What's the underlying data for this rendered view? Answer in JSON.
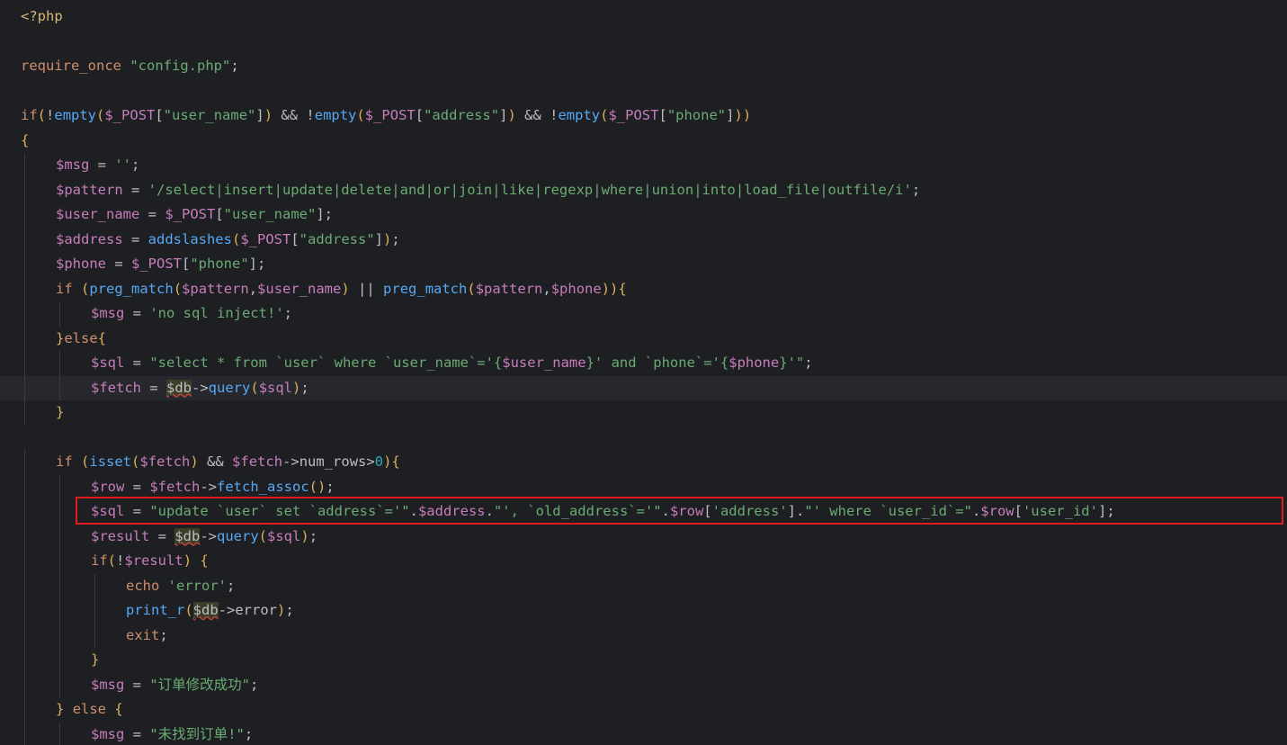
{
  "accent_colors": {
    "keyword": "#cf8e6d",
    "string": "#6aab73",
    "variable": "#c77dbb",
    "function": "#56a8f5",
    "highlight_box": "#e01c1c"
  },
  "lines": [
    {
      "indent": 0,
      "tokens": [
        [
          "tag",
          "<?php"
        ]
      ]
    },
    {
      "indent": 0,
      "tokens": []
    },
    {
      "indent": 0,
      "tokens": [
        [
          "kw",
          "require_once"
        ],
        [
          "pn",
          " "
        ],
        [
          "str",
          "\"config.php\""
        ],
        [
          "pn",
          ";"
        ]
      ]
    },
    {
      "indent": 0,
      "tokens": []
    },
    {
      "indent": 0,
      "tokens": [
        [
          "kw",
          "if"
        ],
        [
          "br",
          "("
        ],
        [
          "op",
          "!"
        ],
        [
          "fn",
          "empty"
        ],
        [
          "br",
          "("
        ],
        [
          "var",
          "$_POST"
        ],
        [
          "pn",
          "["
        ],
        [
          "str",
          "\"user_name\""
        ],
        [
          "pn",
          "]"
        ],
        [
          "br",
          ")"
        ],
        [
          "op",
          " && !"
        ],
        [
          "fn",
          "empty"
        ],
        [
          "br",
          "("
        ],
        [
          "var",
          "$_POST"
        ],
        [
          "pn",
          "["
        ],
        [
          "str",
          "\"address\""
        ],
        [
          "pn",
          "]"
        ],
        [
          "br",
          ")"
        ],
        [
          "op",
          " && !"
        ],
        [
          "fn",
          "empty"
        ],
        [
          "br",
          "("
        ],
        [
          "var",
          "$_POST"
        ],
        [
          "pn",
          "["
        ],
        [
          "str",
          "\"phone\""
        ],
        [
          "pn",
          "]"
        ],
        [
          "br",
          ")"
        ],
        [
          "br",
          ")"
        ]
      ]
    },
    {
      "indent": 0,
      "tokens": [
        [
          "br",
          "{"
        ]
      ]
    },
    {
      "indent": 1,
      "tokens": [
        [
          "var",
          "$msg"
        ],
        [
          "op",
          " = "
        ],
        [
          "str",
          "''"
        ],
        [
          "pn",
          ";"
        ]
      ]
    },
    {
      "indent": 1,
      "tokens": [
        [
          "var",
          "$pattern"
        ],
        [
          "op",
          " = "
        ],
        [
          "str",
          "'/select|insert|update|delete|and|or|join|like|regexp|where|union|into|load_file|outfile/i'"
        ],
        [
          "pn",
          ";"
        ]
      ]
    },
    {
      "indent": 1,
      "tokens": [
        [
          "var",
          "$user_name"
        ],
        [
          "op",
          " = "
        ],
        [
          "var",
          "$_POST"
        ],
        [
          "pn",
          "["
        ],
        [
          "str",
          "\"user_name\""
        ],
        [
          "pn",
          "]"
        ],
        [
          "pn",
          ";"
        ]
      ]
    },
    {
      "indent": 1,
      "tokens": [
        [
          "var",
          "$address"
        ],
        [
          "op",
          " = "
        ],
        [
          "fn",
          "addslashes"
        ],
        [
          "br",
          "("
        ],
        [
          "var",
          "$_POST"
        ],
        [
          "pn",
          "["
        ],
        [
          "str",
          "\"address\""
        ],
        [
          "pn",
          "]"
        ],
        [
          "br",
          ")"
        ],
        [
          "pn",
          ";"
        ]
      ]
    },
    {
      "indent": 1,
      "tokens": [
        [
          "var",
          "$phone"
        ],
        [
          "op",
          " = "
        ],
        [
          "var",
          "$_POST"
        ],
        [
          "pn",
          "["
        ],
        [
          "str",
          "\"phone\""
        ],
        [
          "pn",
          "]"
        ],
        [
          "pn",
          ";"
        ]
      ]
    },
    {
      "indent": 1,
      "tokens": [
        [
          "kw",
          "if"
        ],
        [
          "pn",
          " "
        ],
        [
          "br",
          "("
        ],
        [
          "fn",
          "preg_match"
        ],
        [
          "br",
          "("
        ],
        [
          "var",
          "$pattern"
        ],
        [
          "pn",
          ","
        ],
        [
          "var",
          "$user_name"
        ],
        [
          "br",
          ")"
        ],
        [
          "op",
          " || "
        ],
        [
          "fn",
          "preg_match"
        ],
        [
          "br",
          "("
        ],
        [
          "var",
          "$pattern"
        ],
        [
          "pn",
          ","
        ],
        [
          "var",
          "$phone"
        ],
        [
          "br",
          ")"
        ],
        [
          "br",
          ")"
        ],
        [
          "br",
          "{"
        ]
      ]
    },
    {
      "indent": 2,
      "tokens": [
        [
          "var",
          "$msg"
        ],
        [
          "op",
          " = "
        ],
        [
          "str",
          "'no sql inject!'"
        ],
        [
          "pn",
          ";"
        ]
      ]
    },
    {
      "indent": 1,
      "tokens": [
        [
          "br",
          "}"
        ],
        [
          "kw",
          "else"
        ],
        [
          "br",
          "{"
        ]
      ]
    },
    {
      "indent": 2,
      "tokens": [
        [
          "var",
          "$sql"
        ],
        [
          "op",
          " = "
        ],
        [
          "str",
          "\"select * from `user` where `user_name`='{"
        ],
        [
          "var",
          "$user_name"
        ],
        [
          "str",
          "}' and `phone`='{"
        ],
        [
          "var",
          "$phone"
        ],
        [
          "str",
          "}'\""
        ],
        [
          "pn",
          ";"
        ]
      ]
    },
    {
      "indent": 2,
      "current": true,
      "tokens": [
        [
          "var",
          "$fetch"
        ],
        [
          "op",
          " = "
        ],
        [
          "hl",
          "$db"
        ],
        [
          "op",
          "->"
        ],
        [
          "fn",
          "query"
        ],
        [
          "br",
          "("
        ],
        [
          "var",
          "$sql"
        ],
        [
          "br",
          ")"
        ],
        [
          "pn",
          ";"
        ]
      ]
    },
    {
      "indent": 1,
      "tokens": [
        [
          "br",
          "}"
        ]
      ]
    },
    {
      "indent": 0,
      "tokens": []
    },
    {
      "indent": 1,
      "tokens": [
        [
          "kw",
          "if"
        ],
        [
          "pn",
          " "
        ],
        [
          "br",
          "("
        ],
        [
          "fn",
          "isset"
        ],
        [
          "br",
          "("
        ],
        [
          "var",
          "$fetch"
        ],
        [
          "br",
          ")"
        ],
        [
          "op",
          " && "
        ],
        [
          "var",
          "$fetch"
        ],
        [
          "op",
          "->"
        ],
        [
          "pn",
          "num_rows"
        ],
        [
          "op",
          ">"
        ],
        [
          "num",
          "0"
        ],
        [
          "br",
          ")"
        ],
        [
          "br",
          "{"
        ]
      ]
    },
    {
      "indent": 2,
      "tokens": [
        [
          "var",
          "$row"
        ],
        [
          "op",
          " = "
        ],
        [
          "var",
          "$fetch"
        ],
        [
          "op",
          "->"
        ],
        [
          "fn",
          "fetch_assoc"
        ],
        [
          "br",
          "()"
        ],
        [
          "pn",
          ";"
        ]
      ]
    },
    {
      "indent": 2,
      "boxed": true,
      "tokens": [
        [
          "var",
          "$sql"
        ],
        [
          "op",
          " = "
        ],
        [
          "str",
          "\"update `user` set `address`='\""
        ],
        [
          "op",
          "."
        ],
        [
          "var",
          "$address"
        ],
        [
          "op",
          "."
        ],
        [
          "str",
          "\"', `old_address`='\""
        ],
        [
          "op",
          "."
        ],
        [
          "var",
          "$row"
        ],
        [
          "pn",
          "["
        ],
        [
          "str",
          "'address'"
        ],
        [
          "pn",
          "]"
        ],
        [
          "op",
          "."
        ],
        [
          "str",
          "\"' where `user_id`=\""
        ],
        [
          "op",
          "."
        ],
        [
          "var",
          "$row"
        ],
        [
          "pn",
          "["
        ],
        [
          "str",
          "'user_id'"
        ],
        [
          "pn",
          "]"
        ],
        [
          "pn",
          ";"
        ]
      ]
    },
    {
      "indent": 2,
      "tokens": [
        [
          "var",
          "$result"
        ],
        [
          "op",
          " = "
        ],
        [
          "hl",
          "$db"
        ],
        [
          "op",
          "->"
        ],
        [
          "fn",
          "query"
        ],
        [
          "br",
          "("
        ],
        [
          "var",
          "$sql"
        ],
        [
          "br",
          ")"
        ],
        [
          "pn",
          ";"
        ]
      ]
    },
    {
      "indent": 2,
      "tokens": [
        [
          "kw",
          "if"
        ],
        [
          "br",
          "("
        ],
        [
          "op",
          "!"
        ],
        [
          "var",
          "$result"
        ],
        [
          "br",
          ")"
        ],
        [
          "pn",
          " "
        ],
        [
          "br",
          "{"
        ]
      ]
    },
    {
      "indent": 3,
      "tokens": [
        [
          "kw",
          "echo"
        ],
        [
          "pn",
          " "
        ],
        [
          "str",
          "'error'"
        ],
        [
          "pn",
          ";"
        ]
      ]
    },
    {
      "indent": 3,
      "tokens": [
        [
          "fn",
          "print_r"
        ],
        [
          "br",
          "("
        ],
        [
          "hl",
          "$db"
        ],
        [
          "op",
          "->"
        ],
        [
          "pn",
          "error"
        ],
        [
          "br",
          ")"
        ],
        [
          "pn",
          ";"
        ]
      ]
    },
    {
      "indent": 3,
      "tokens": [
        [
          "kw",
          "exit"
        ],
        [
          "pn",
          ";"
        ]
      ]
    },
    {
      "indent": 2,
      "tokens": [
        [
          "br",
          "}"
        ]
      ]
    },
    {
      "indent": 2,
      "tokens": [
        [
          "var",
          "$msg"
        ],
        [
          "op",
          " = "
        ],
        [
          "str",
          "\"订单修改成功\""
        ],
        [
          "pn",
          ";"
        ]
      ]
    },
    {
      "indent": 1,
      "tokens": [
        [
          "br",
          "}"
        ],
        [
          "pn",
          " "
        ],
        [
          "kw",
          "else"
        ],
        [
          "pn",
          " "
        ],
        [
          "br",
          "{"
        ]
      ]
    },
    {
      "indent": 2,
      "tokens": [
        [
          "var",
          "$msg"
        ],
        [
          "op",
          " = "
        ],
        [
          "str",
          "\"未找到订单!\""
        ],
        [
          "pn",
          ";"
        ]
      ]
    }
  ]
}
